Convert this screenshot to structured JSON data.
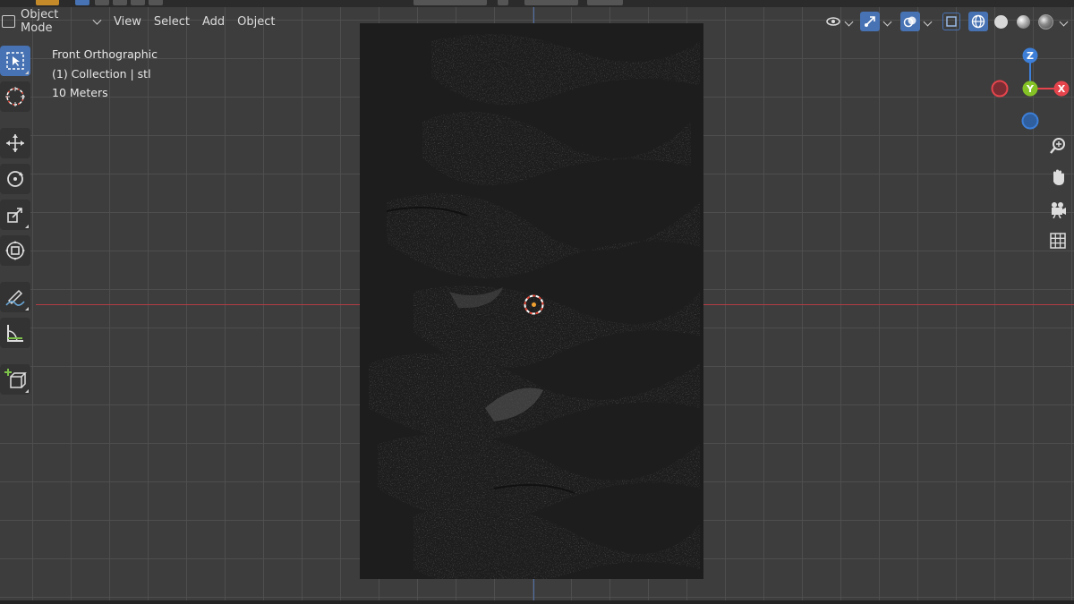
{
  "header": {
    "mode_label": "Object Mode",
    "menus": [
      "View",
      "Select",
      "Add",
      "Object"
    ]
  },
  "overlay": {
    "view_name": "Front Orthographic",
    "collection": "(1) Collection | stl",
    "scale": "10 Meters"
  },
  "gizmo": {
    "z_label": "Z",
    "y_label": "Y",
    "x_label": "X"
  },
  "colors": {
    "accent": "#4772b3",
    "x_axis": "#b33c45",
    "z_axis": "#4f6fa8",
    "gizmo_x": "#e5444c",
    "gizmo_y": "#84c225",
    "gizmo_z": "#3d7fd8",
    "cursor": "#e74c3c",
    "origin": "#f0a030"
  },
  "icons": {
    "toolbar": [
      "select-box-icon",
      "cursor-icon",
      "move-icon",
      "rotate-icon",
      "scale-icon",
      "transform-icon",
      "annotate-icon",
      "measure-icon",
      "add-cube-icon"
    ],
    "navigation": [
      "zoom-icon",
      "hand-pan-icon",
      "camera-icon",
      "grid-icon"
    ]
  }
}
